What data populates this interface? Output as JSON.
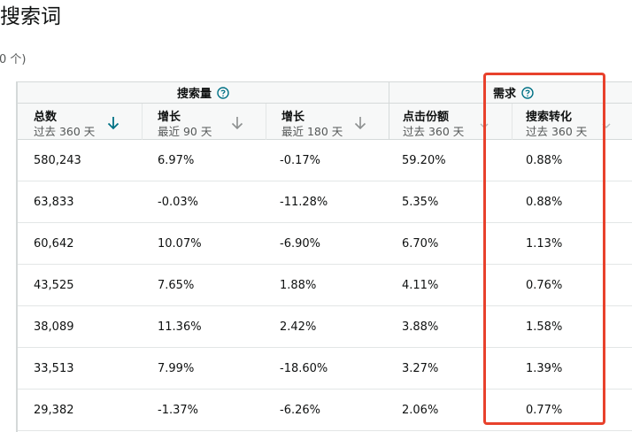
{
  "page": {
    "title": "搜索词",
    "subtitle": "0 个)"
  },
  "groups": {
    "search_volume": "搜索量",
    "demand": "需求"
  },
  "columns": [
    {
      "title": "总数",
      "sub": "过去 360 天",
      "sort": "active"
    },
    {
      "title": "增长",
      "sub": "最近 90 天",
      "sort": "inactive"
    },
    {
      "title": "增长",
      "sub": "最近 180 天",
      "sort": "inactive"
    },
    {
      "title": "点击份额",
      "sub": "过去 360 天",
      "sort": "inactive"
    },
    {
      "title": "搜索转化",
      "sub": "过去 360 天",
      "sort": "inactive"
    }
  ],
  "rows": [
    {
      "total": "580,243",
      "growth90": "6.97%",
      "growth180": "-0.17%",
      "click_share": "59.20%",
      "conversion": "0.88%"
    },
    {
      "total": "63,833",
      "growth90": "-0.03%",
      "growth180": "-11.28%",
      "click_share": "5.35%",
      "conversion": "0.88%"
    },
    {
      "total": "60,642",
      "growth90": "10.07%",
      "growth180": "-6.90%",
      "click_share": "6.70%",
      "conversion": "1.13%"
    },
    {
      "total": "43,525",
      "growth90": "7.65%",
      "growth180": "1.88%",
      "click_share": "4.11%",
      "conversion": "0.76%"
    },
    {
      "total": "38,089",
      "growth90": "11.36%",
      "growth180": "2.42%",
      "click_share": "3.88%",
      "conversion": "1.58%"
    },
    {
      "total": "33,513",
      "growth90": "7.99%",
      "growth180": "-18.60%",
      "click_share": "3.27%",
      "conversion": "1.39%"
    },
    {
      "total": "29,382",
      "growth90": "-1.37%",
      "growth180": "-6.26%",
      "click_share": "2.06%",
      "conversion": "0.77%"
    }
  ],
  "icons": {
    "help": "question-circle-icon",
    "sort_active": "arrow-down-icon",
    "sort_inactive": "arrow-down-icon",
    "sort_faded": "chevron-down-icon"
  },
  "colors": {
    "accent": "#007185",
    "highlight": "#e8412c",
    "header_bg": "#f7f8f8",
    "border": "#d5d9d9"
  }
}
